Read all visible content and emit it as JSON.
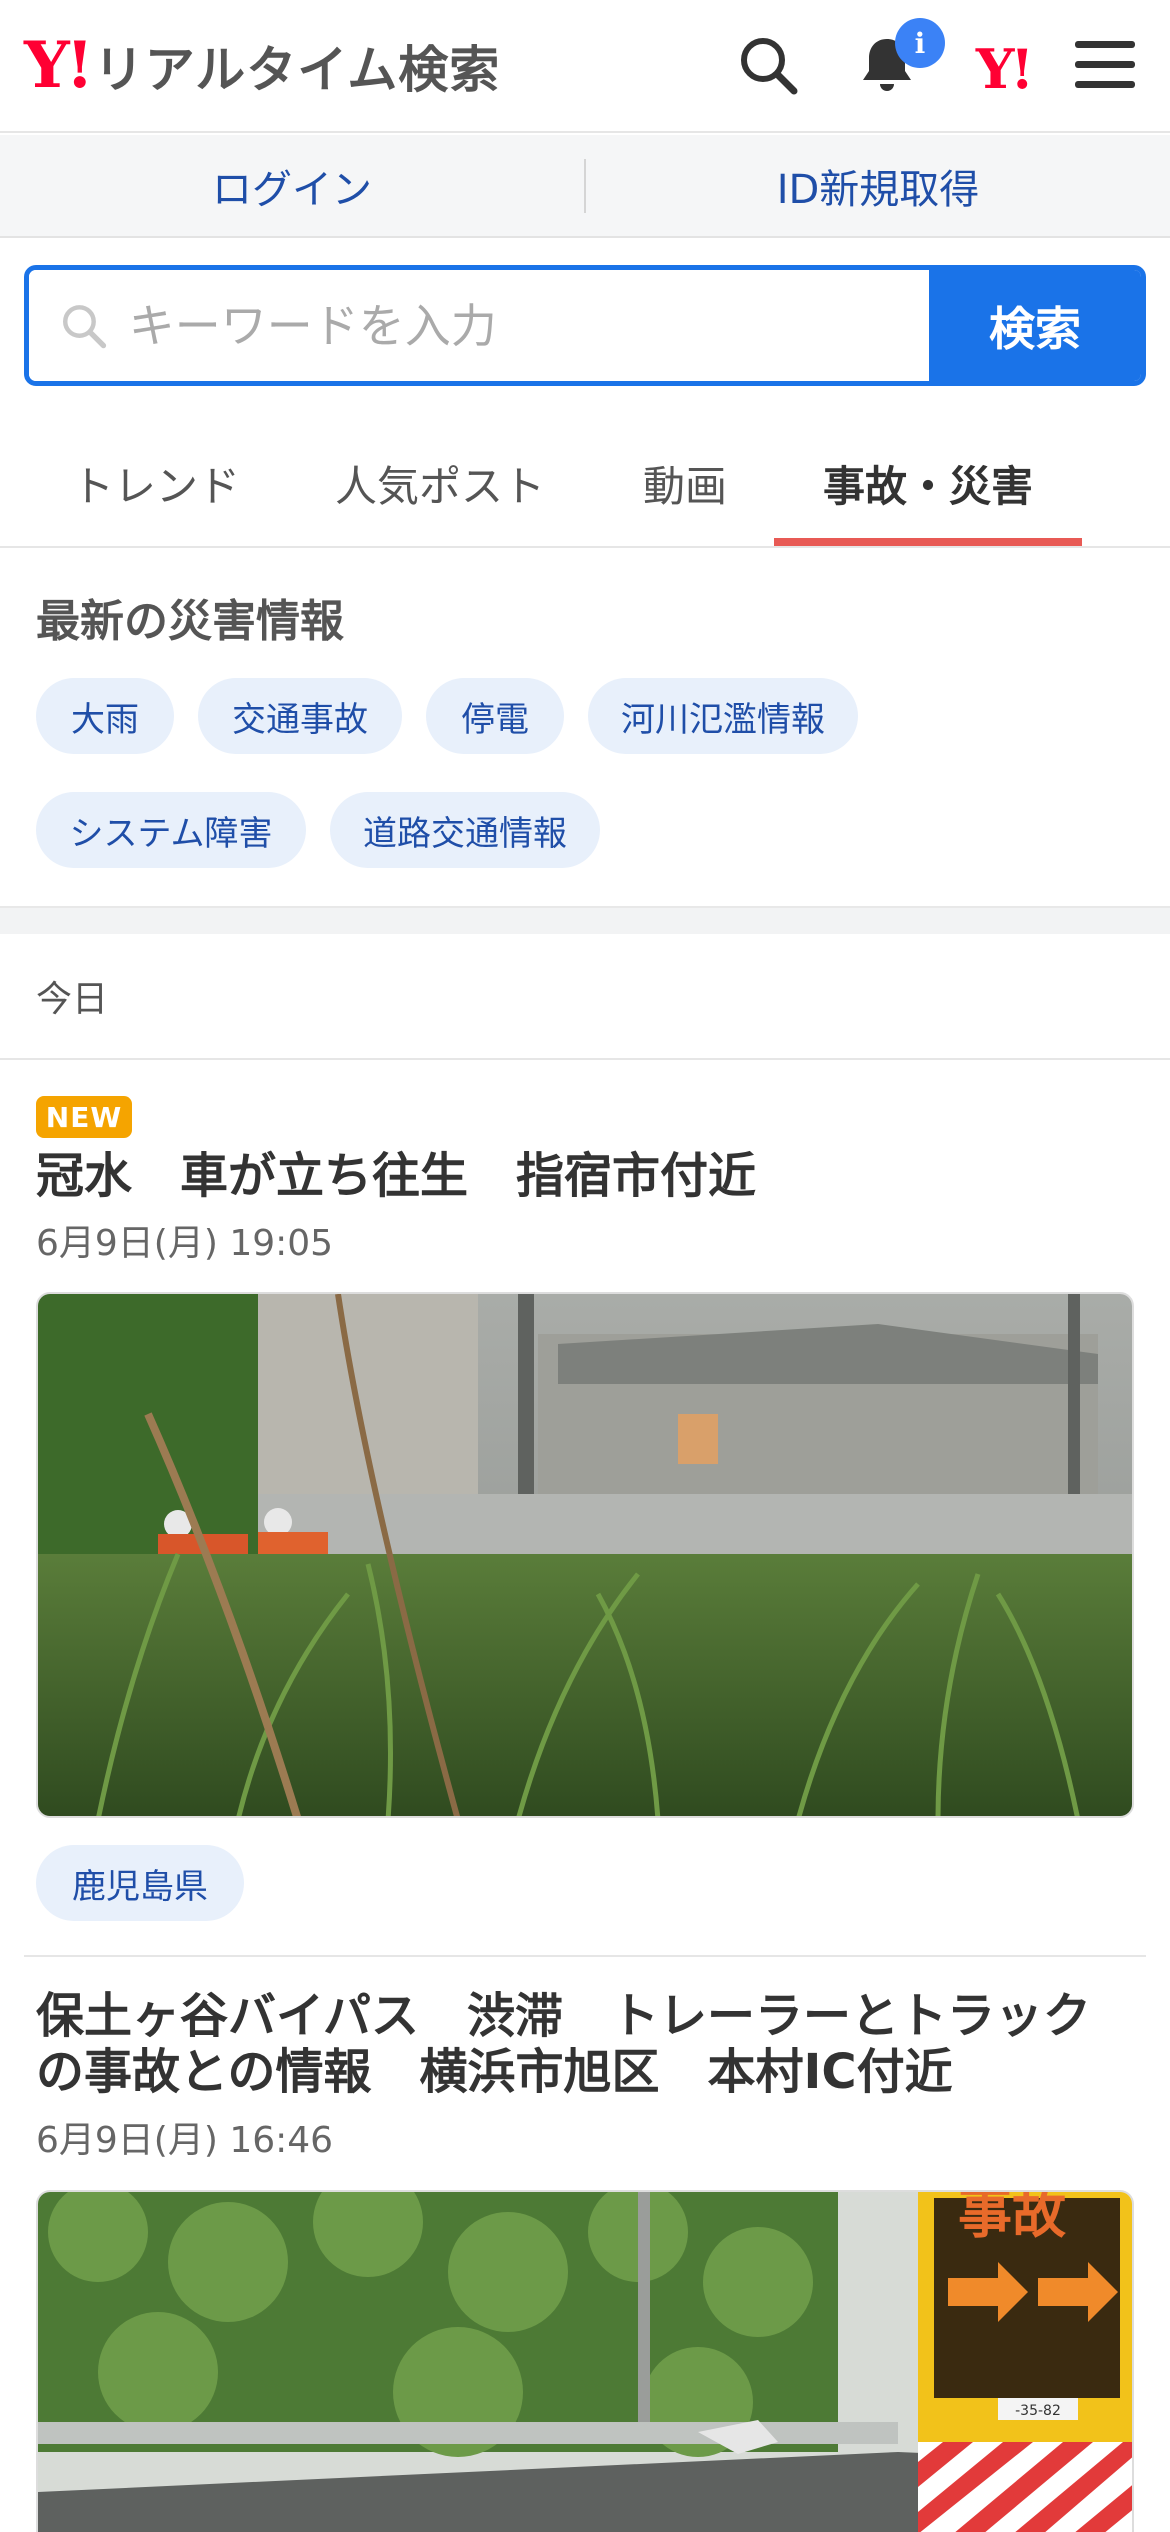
{
  "header": {
    "logo_mark": "Y!",
    "logo_text": "リアルタイム検索",
    "notification_badge": "i",
    "yahoo_mark": "Y!"
  },
  "account": {
    "login": "ログイン",
    "register": "ID新規取得"
  },
  "search": {
    "placeholder": "キーワードを入力",
    "button": "検索"
  },
  "tabs": [
    {
      "label": "トレンド",
      "active": false
    },
    {
      "label": "人気ポスト",
      "active": false
    },
    {
      "label": "動画",
      "active": false
    },
    {
      "label": "事故・災害",
      "active": true
    }
  ],
  "disaster": {
    "title": "最新の災害情報",
    "chips": [
      "大雨",
      "交通事故",
      "停電",
      "河川氾濫情報",
      "システム障害",
      "道路交通情報"
    ]
  },
  "feed": {
    "date_heading": "今日",
    "articles": [
      {
        "badge": "NEW",
        "title": "冠水　車が立ち往生　指宿市付近",
        "time": "6月9日(月) 19:05",
        "tag": "鹿児島県"
      },
      {
        "title_line1": "保土ヶ谷バイパス　渋滞　トレーラーとトラック",
        "title_line2": "の事故との情報　横浜市旭区　本村IC付近",
        "time": "6月9日(月) 16:46",
        "sign_text": "事故",
        "plate": "-35-82"
      }
    ]
  },
  "colors": {
    "accent": "#1a73e8",
    "brand": "#ff0033",
    "tab_underline": "#e85a55",
    "new_badge": "#f5a400"
  }
}
